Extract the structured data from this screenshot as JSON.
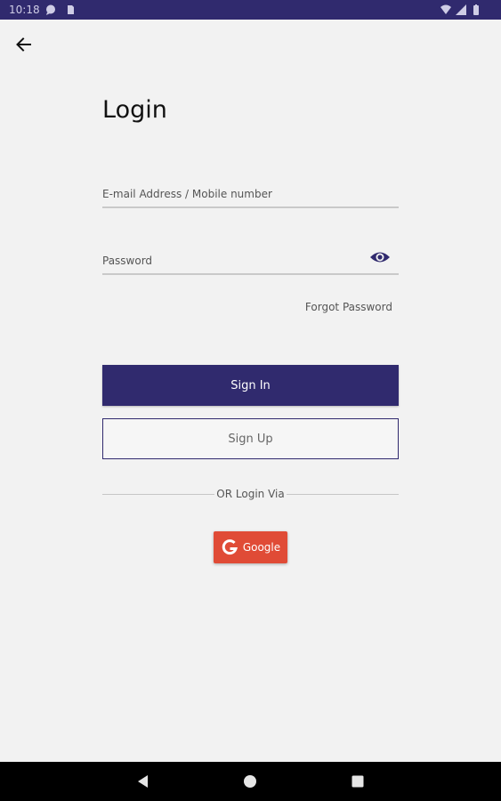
{
  "status_bar": {
    "time": "10:18",
    "left_icons": [
      "chat-icon",
      "sim-card-icon"
    ],
    "right_icons": [
      "wifi-icon",
      "signal-icon",
      "battery-icon"
    ],
    "background": "#302a6e"
  },
  "header": {
    "back_icon": "arrow-back-icon"
  },
  "login": {
    "title": "Login",
    "email_placeholder": "E-mail Address / Mobile number",
    "password_placeholder": "Password",
    "visibility_icon": "eye-icon",
    "forgot_password": "Forgot Password",
    "sign_in": "Sign In",
    "sign_up": "Sign Up",
    "divider_text": "OR Login Via",
    "google_label": "Google",
    "google_icon": "google-g-icon"
  },
  "nav_bar": {
    "buttons": [
      "back-triangle-icon",
      "home-circle-icon",
      "recents-square-icon"
    ]
  },
  "colors": {
    "primary": "#302a6e",
    "google": "#e04b36",
    "background": "#f2f2f2"
  }
}
